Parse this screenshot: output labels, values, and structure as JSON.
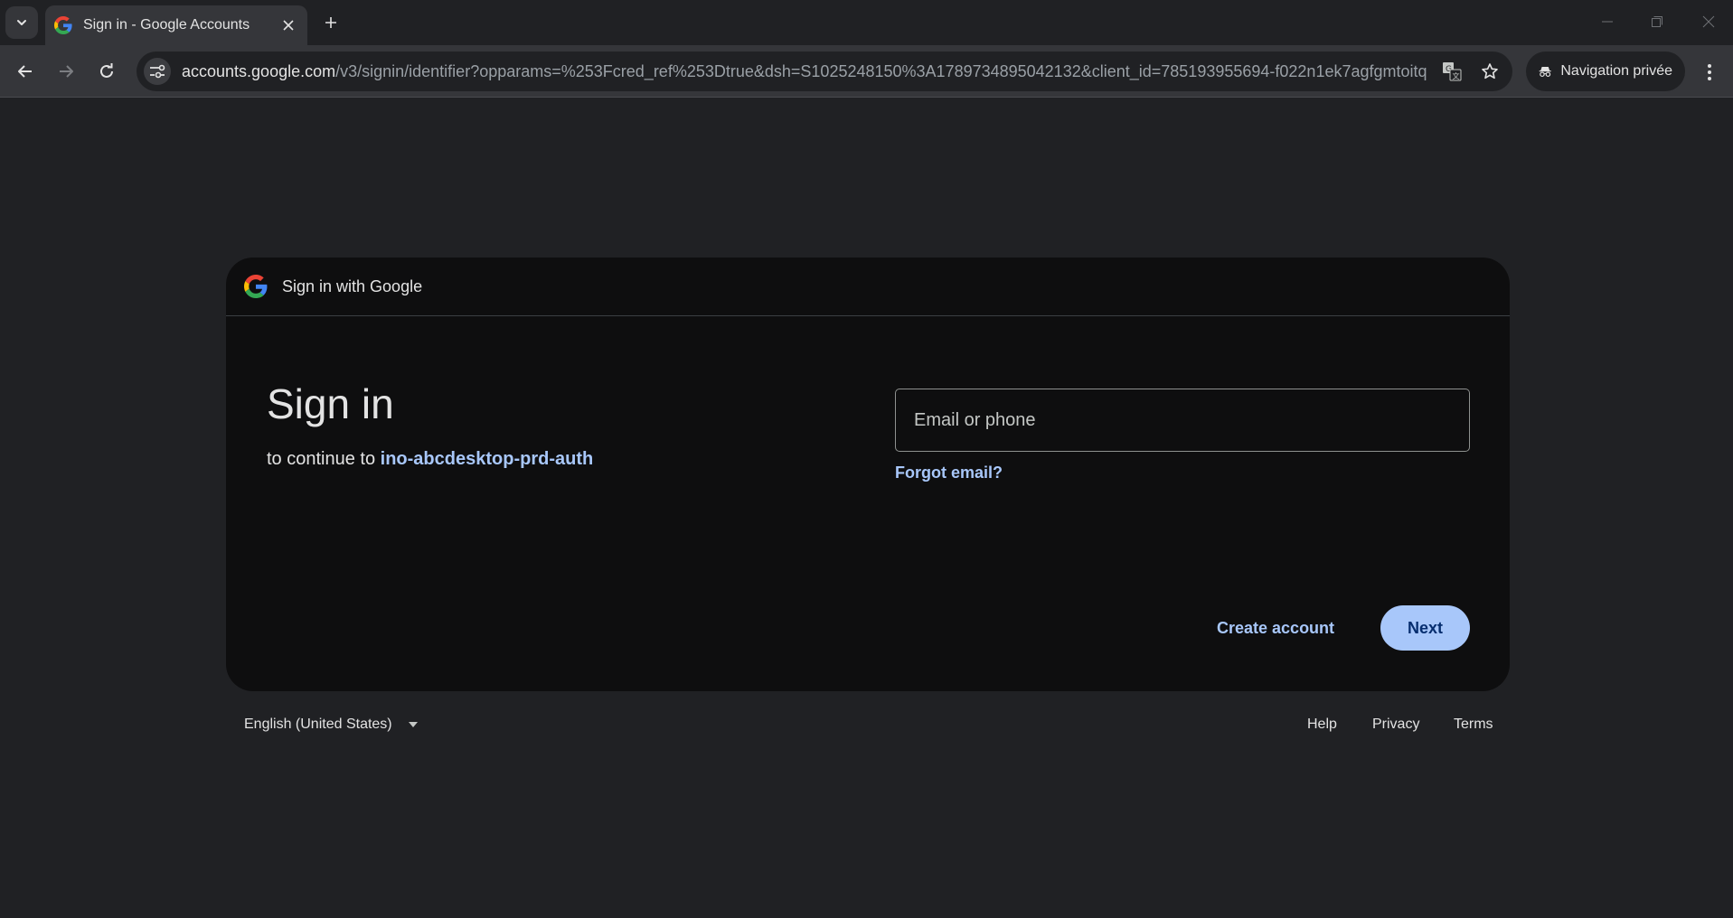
{
  "browser": {
    "tab": {
      "title": "Sign in - Google Accounts",
      "favicon": "google-g-icon"
    },
    "address_bar": {
      "host": "accounts.google.com",
      "path": "/v3/signin/identifier?opparams=%253Fcred_ref%253Dtrue&dsh=S1025248150%3A1789734895042132&client_id=785193955694-f022n1ek7agfgmtoitqhdn..."
    },
    "incognito_label": "Navigation privée",
    "icons": [
      "tab-search-icon",
      "close-icon",
      "plus-icon",
      "minimize-icon",
      "restore-icon",
      "back-arrow-icon",
      "forward-arrow-icon",
      "reload-icon",
      "site-info-icon",
      "translate-icon",
      "star-icon",
      "incognito-icon",
      "kebab-menu-icon"
    ]
  },
  "card": {
    "header_title": "Sign in with Google",
    "heading": "Sign in",
    "subtitle_prefix": "to continue to ",
    "app_name": "ino-abcdesktop-prd-auth",
    "email_placeholder": "Email or phone",
    "forgot_email": "Forgot email?",
    "create_account": "Create account",
    "next": "Next"
  },
  "footer": {
    "language": "English (United States)",
    "help": "Help",
    "privacy": "Privacy",
    "terms": "Terms"
  },
  "colors": {
    "page_bg": "#202124",
    "card_bg": "#0e0e0f",
    "accent": "#a8c7fa",
    "button_text": "#062e6f"
  }
}
